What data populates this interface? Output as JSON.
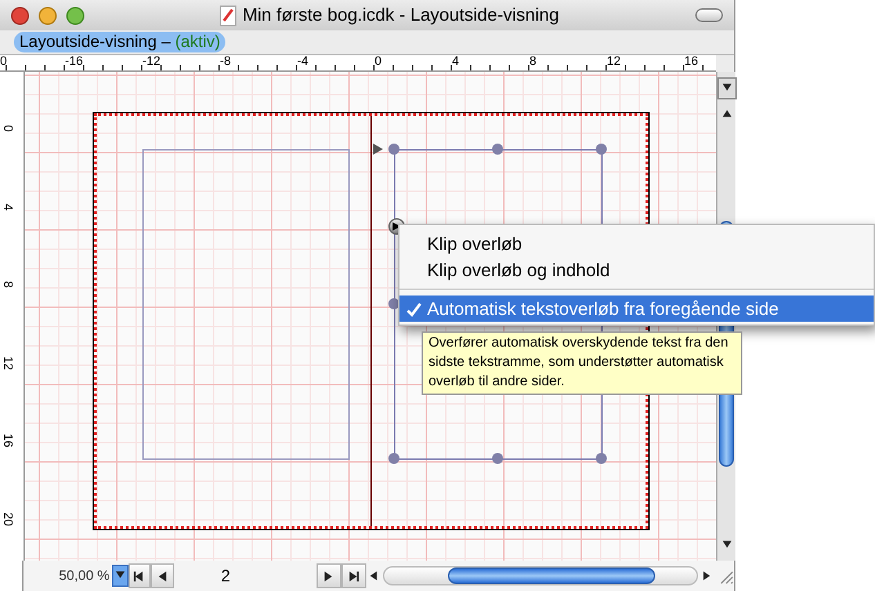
{
  "window": {
    "title": "Min første bog.icdk - Layoutside-visning"
  },
  "tab": {
    "label": "Layoutside-visning –",
    "status": "(aktiv)",
    "selected": true
  },
  "ruler_horizontal": [
    "0",
    "-16",
    "-12",
    "-8",
    "-4",
    "0",
    "4",
    "8",
    "12",
    "16"
  ],
  "ruler_vertical": [
    "0",
    "4",
    "8",
    "12",
    "16",
    "20"
  ],
  "menu": [
    {
      "label": "Klip overløb",
      "checked": false,
      "selected": false,
      "divider_above": false
    },
    {
      "label": "Klip overløb og indhold",
      "checked": false,
      "selected": false,
      "divider_above": false
    },
    {
      "label": "Automatisk tekstoverløb fra foregående side",
      "checked": true,
      "selected": true,
      "divider_above": true
    }
  ],
  "tooltip": "Overfører automatisk overskydende tekst fra den sidste tekstramme, som understøtter automatisk overløb til andre sider.",
  "status_bar": {
    "zoom": "50,00 %",
    "page": "2"
  }
}
